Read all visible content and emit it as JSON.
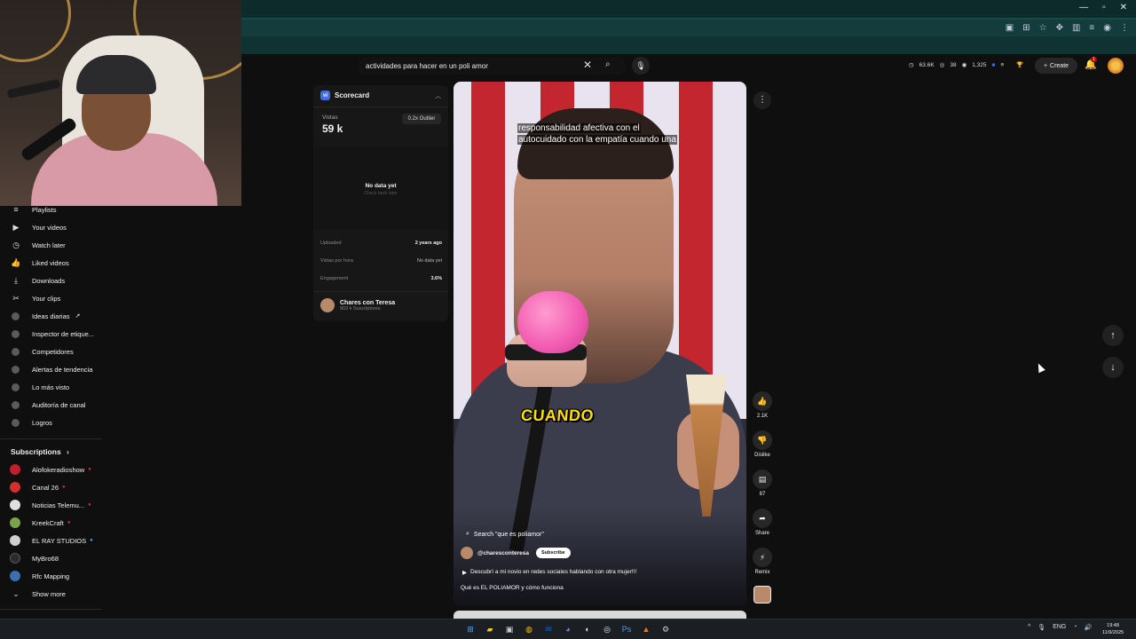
{
  "search": {
    "query": "actividades para hacer en un poli amor"
  },
  "header": {
    "stats": [
      "63.6K",
      "38",
      "1,325"
    ],
    "create_label": "Create",
    "notification_count": "1"
  },
  "sidebar": {
    "items": [
      {
        "icon": "≡",
        "label": "Playlists"
      },
      {
        "icon": "▶",
        "label": "Your videos"
      },
      {
        "icon": "◷",
        "label": "Watch later"
      },
      {
        "icon": "👍",
        "label": "Liked videos"
      },
      {
        "icon": "⤓",
        "label": "Downloads"
      },
      {
        "icon": "✂",
        "label": "Your clips"
      }
    ],
    "tools": [
      {
        "label": "Ideas diarias",
        "external": "↗"
      },
      {
        "label": "Inspector de etique..."
      },
      {
        "label": "Competidores"
      },
      {
        "label": "Alertas de tendencia"
      },
      {
        "label": "Lo más visto"
      },
      {
        "label": "Auditoría de canal"
      },
      {
        "label": "Logros"
      }
    ],
    "subscriptions_title": "Subscriptions",
    "subscriptions": [
      {
        "label": "Alofokeradioshow",
        "color": "#c21f2c"
      },
      {
        "label": "Canal 26",
        "color": "#d32f2f"
      },
      {
        "label": "Noticias Telemu...",
        "color": "#e0e0e0"
      },
      {
        "label": "KreekCraft",
        "color": "#7aa34a"
      },
      {
        "label": "EL RAY STUDIOS",
        "color": "#cfcfcf"
      },
      {
        "label": "MyBro68",
        "color": "#2b2b2b"
      },
      {
        "label": "Rfc Mapping",
        "color": "#3b6fb0"
      }
    ],
    "show_more": "Show more"
  },
  "scorecard": {
    "title": "Scorecard",
    "views_label": "Vistas",
    "views_value": "59 k",
    "outlier": "0.2x Outlier",
    "no_data": "No data yet",
    "no_data_sub": "Check back later",
    "rows": [
      {
        "label": "Uploaded",
        "value": "2 years ago"
      },
      {
        "label": "Vistas por hora",
        "value": "No data yet"
      },
      {
        "label": "Engagement",
        "value": "3.6%"
      }
    ],
    "channel_name": "Chares con Teresa",
    "channel_subs": "903 k Suscriptores"
  },
  "short": {
    "caption_line1": "responsabilidad afectiva con el",
    "caption_line2": "autocuidado con la empatía cuando una",
    "overlay_word": "CUANDO",
    "related_search": "Search \"que es poliamor\"",
    "channel_handle": "@charesconteresa",
    "subscribe_label": "Subscribe",
    "playlist_title": "Descubrí a mi novio en redes sociales hablando con otra mujer!!!",
    "title": "Qué es EL POLIAMOR y cómo funciona"
  },
  "actions": {
    "like_count": "2.1K",
    "dislike_label": "Dislike",
    "comment_count": "87",
    "share_label": "Share",
    "remix_label": "Remix"
  },
  "taskbar": {
    "lang": "ENG",
    "time": "19:48",
    "date": "11/9/2025"
  }
}
